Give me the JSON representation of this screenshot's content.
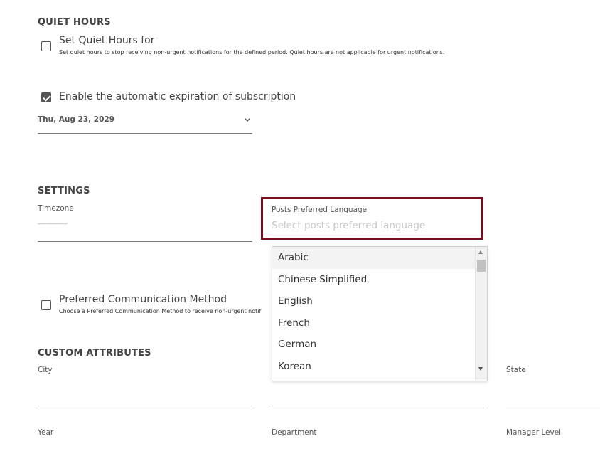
{
  "quiet_hours": {
    "title": "QUIET HOURS",
    "checkbox_label": "Set Quiet Hours for",
    "description": "Set quiet hours to stop receiving non-urgent notifications for the defined period. Quiet hours are not applicable for urgent notifications.",
    "checked": false
  },
  "expiration": {
    "checkbox_label": "Enable the automatic expiration of subscription",
    "checked": true,
    "date_value": "Thu, Aug 23, 2029"
  },
  "settings": {
    "title": "SETTINGS",
    "timezone_label": "Timezone",
    "timezone_value": "---------------",
    "language_label": "Posts Preferred Language",
    "language_placeholder": "Select posts preferred language",
    "language_options": [
      "Arabic",
      "Chinese Simplified",
      "English",
      "French",
      "German",
      "Korean"
    ]
  },
  "communication": {
    "checkbox_label": "Preferred Communication Method",
    "description": "Choose a Preferred Communication Method to receive non-urgent notif",
    "checked": false
  },
  "custom_attributes": {
    "title": "CUSTOM ATTRIBUTES",
    "city_label": "City",
    "state_label": "State",
    "year_label": "Year",
    "department_label": "Department",
    "manager_level_label": "Manager Level"
  },
  "colors": {
    "focus_border": "#7a0b1e",
    "checkbox_checked": "#555555"
  }
}
